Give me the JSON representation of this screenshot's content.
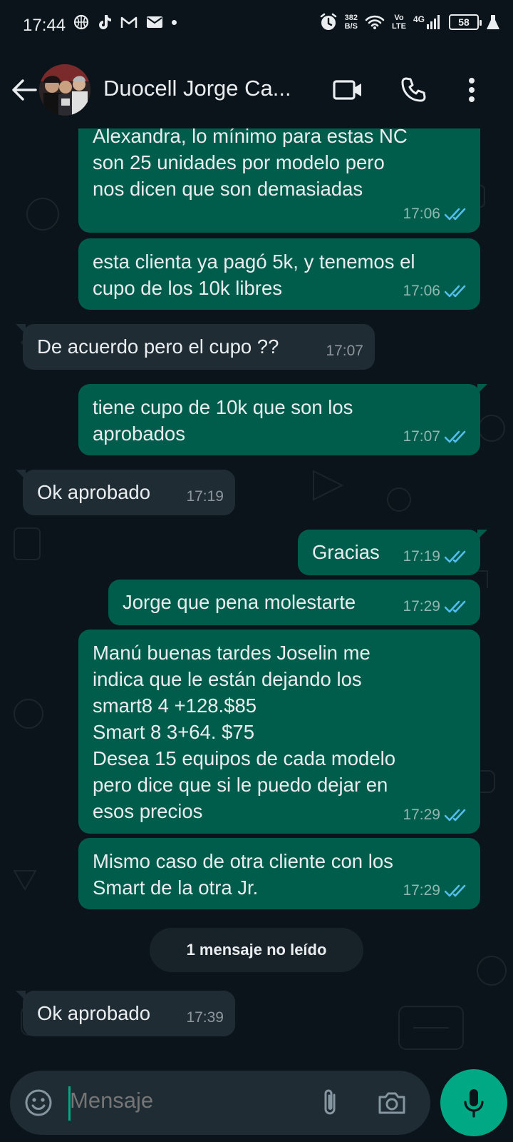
{
  "status_bar": {
    "time": "17:44",
    "net_speed_value": "382",
    "net_speed_unit": "B/S",
    "volte_top": "Vo",
    "volte_bottom": "LTE",
    "network": "4G",
    "battery": "58"
  },
  "header": {
    "contact_name": "Duocell Jorge Ca...",
    "icons": [
      "back-arrow-icon",
      "video-call-icon",
      "phone-call-icon",
      "more-vert-icon"
    ]
  },
  "messages": [
    {
      "direction": "out",
      "text": "Alexandra, lo mínimo para estas NC\nson 25 unidades por modelo pero\nnos dicen que son demasiadas",
      "time": "17:06",
      "status": "read"
    },
    {
      "direction": "out",
      "text": "esta clienta ya pagó 5k, y tenemos el\ncupo de los 10k libres",
      "time": "17:06",
      "status": "read"
    },
    {
      "direction": "in",
      "text": "De acuerdo pero el cupo ??",
      "time": "17:07"
    },
    {
      "direction": "out",
      "text": "tiene cupo de 10k que son los\naprobados",
      "time": "17:07",
      "status": "read"
    },
    {
      "direction": "in",
      "text": "Ok aprobado",
      "time": "17:19"
    },
    {
      "direction": "out",
      "text": "Gracias",
      "time": "17:19",
      "status": "read"
    },
    {
      "direction": "out",
      "text": "Jorge que pena molestarte",
      "time": "17:29",
      "status": "read"
    },
    {
      "direction": "out",
      "text": "Manú buenas tardes Joselin me\nindica que le están dejando los\nsmart8 4 +128.$85\nSmart 8 3+64. $75\nDesea 15 equipos de cada modelo\npero dice que si le puedo dejar en\nesos precios",
      "time": "17:29",
      "status": "read"
    },
    {
      "direction": "out",
      "text": "Mismo caso de otra cliente con los\nSmart de la otra Jr.",
      "time": "17:29",
      "status": "read"
    },
    {
      "direction": "in",
      "text": "Ok aprobado",
      "time": "17:39"
    }
  ],
  "unread_label": "1 mensaje no leído",
  "composer": {
    "placeholder": "Mensaje",
    "value": ""
  },
  "colors": {
    "background": "#0b141a",
    "outgoing_bubble": "#005c4b",
    "incoming_bubble": "#1f2c34",
    "accent": "#00a884",
    "read_ticks": "#53bdeb"
  }
}
